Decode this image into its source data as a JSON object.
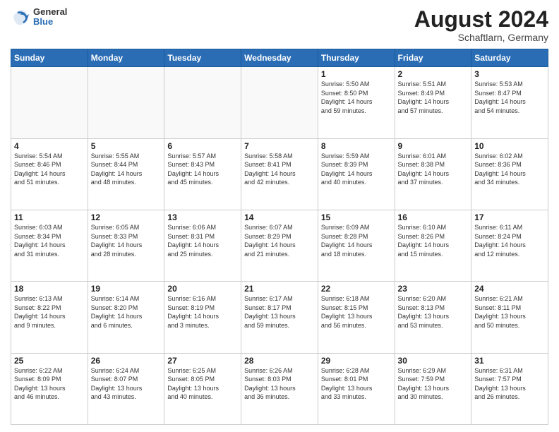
{
  "header": {
    "logo_line1": "General",
    "logo_line2": "Blue",
    "month_year": "August 2024",
    "location": "Schaftlarn, Germany"
  },
  "weekdays": [
    "Sunday",
    "Monday",
    "Tuesday",
    "Wednesday",
    "Thursday",
    "Friday",
    "Saturday"
  ],
  "weeks": [
    [
      {
        "day": "",
        "info": ""
      },
      {
        "day": "",
        "info": ""
      },
      {
        "day": "",
        "info": ""
      },
      {
        "day": "",
        "info": ""
      },
      {
        "day": "1",
        "info": "Sunrise: 5:50 AM\nSunset: 8:50 PM\nDaylight: 14 hours\nand 59 minutes."
      },
      {
        "day": "2",
        "info": "Sunrise: 5:51 AM\nSunset: 8:49 PM\nDaylight: 14 hours\nand 57 minutes."
      },
      {
        "day": "3",
        "info": "Sunrise: 5:53 AM\nSunset: 8:47 PM\nDaylight: 14 hours\nand 54 minutes."
      }
    ],
    [
      {
        "day": "4",
        "info": "Sunrise: 5:54 AM\nSunset: 8:46 PM\nDaylight: 14 hours\nand 51 minutes."
      },
      {
        "day": "5",
        "info": "Sunrise: 5:55 AM\nSunset: 8:44 PM\nDaylight: 14 hours\nand 48 minutes."
      },
      {
        "day": "6",
        "info": "Sunrise: 5:57 AM\nSunset: 8:43 PM\nDaylight: 14 hours\nand 45 minutes."
      },
      {
        "day": "7",
        "info": "Sunrise: 5:58 AM\nSunset: 8:41 PM\nDaylight: 14 hours\nand 42 minutes."
      },
      {
        "day": "8",
        "info": "Sunrise: 5:59 AM\nSunset: 8:39 PM\nDaylight: 14 hours\nand 40 minutes."
      },
      {
        "day": "9",
        "info": "Sunrise: 6:01 AM\nSunset: 8:38 PM\nDaylight: 14 hours\nand 37 minutes."
      },
      {
        "day": "10",
        "info": "Sunrise: 6:02 AM\nSunset: 8:36 PM\nDaylight: 14 hours\nand 34 minutes."
      }
    ],
    [
      {
        "day": "11",
        "info": "Sunrise: 6:03 AM\nSunset: 8:34 PM\nDaylight: 14 hours\nand 31 minutes."
      },
      {
        "day": "12",
        "info": "Sunrise: 6:05 AM\nSunset: 8:33 PM\nDaylight: 14 hours\nand 28 minutes."
      },
      {
        "day": "13",
        "info": "Sunrise: 6:06 AM\nSunset: 8:31 PM\nDaylight: 14 hours\nand 25 minutes."
      },
      {
        "day": "14",
        "info": "Sunrise: 6:07 AM\nSunset: 8:29 PM\nDaylight: 14 hours\nand 21 minutes."
      },
      {
        "day": "15",
        "info": "Sunrise: 6:09 AM\nSunset: 8:28 PM\nDaylight: 14 hours\nand 18 minutes."
      },
      {
        "day": "16",
        "info": "Sunrise: 6:10 AM\nSunset: 8:26 PM\nDaylight: 14 hours\nand 15 minutes."
      },
      {
        "day": "17",
        "info": "Sunrise: 6:11 AM\nSunset: 8:24 PM\nDaylight: 14 hours\nand 12 minutes."
      }
    ],
    [
      {
        "day": "18",
        "info": "Sunrise: 6:13 AM\nSunset: 8:22 PM\nDaylight: 14 hours\nand 9 minutes."
      },
      {
        "day": "19",
        "info": "Sunrise: 6:14 AM\nSunset: 8:20 PM\nDaylight: 14 hours\nand 6 minutes."
      },
      {
        "day": "20",
        "info": "Sunrise: 6:16 AM\nSunset: 8:19 PM\nDaylight: 14 hours\nand 3 minutes."
      },
      {
        "day": "21",
        "info": "Sunrise: 6:17 AM\nSunset: 8:17 PM\nDaylight: 13 hours\nand 59 minutes."
      },
      {
        "day": "22",
        "info": "Sunrise: 6:18 AM\nSunset: 8:15 PM\nDaylight: 13 hours\nand 56 minutes."
      },
      {
        "day": "23",
        "info": "Sunrise: 6:20 AM\nSunset: 8:13 PM\nDaylight: 13 hours\nand 53 minutes."
      },
      {
        "day": "24",
        "info": "Sunrise: 6:21 AM\nSunset: 8:11 PM\nDaylight: 13 hours\nand 50 minutes."
      }
    ],
    [
      {
        "day": "25",
        "info": "Sunrise: 6:22 AM\nSunset: 8:09 PM\nDaylight: 13 hours\nand 46 minutes."
      },
      {
        "day": "26",
        "info": "Sunrise: 6:24 AM\nSunset: 8:07 PM\nDaylight: 13 hours\nand 43 minutes."
      },
      {
        "day": "27",
        "info": "Sunrise: 6:25 AM\nSunset: 8:05 PM\nDaylight: 13 hours\nand 40 minutes."
      },
      {
        "day": "28",
        "info": "Sunrise: 6:26 AM\nSunset: 8:03 PM\nDaylight: 13 hours\nand 36 minutes."
      },
      {
        "day": "29",
        "info": "Sunrise: 6:28 AM\nSunset: 8:01 PM\nDaylight: 13 hours\nand 33 minutes."
      },
      {
        "day": "30",
        "info": "Sunrise: 6:29 AM\nSunset: 7:59 PM\nDaylight: 13 hours\nand 30 minutes."
      },
      {
        "day": "31",
        "info": "Sunrise: 6:31 AM\nSunset: 7:57 PM\nDaylight: 13 hours\nand 26 minutes."
      }
    ]
  ]
}
